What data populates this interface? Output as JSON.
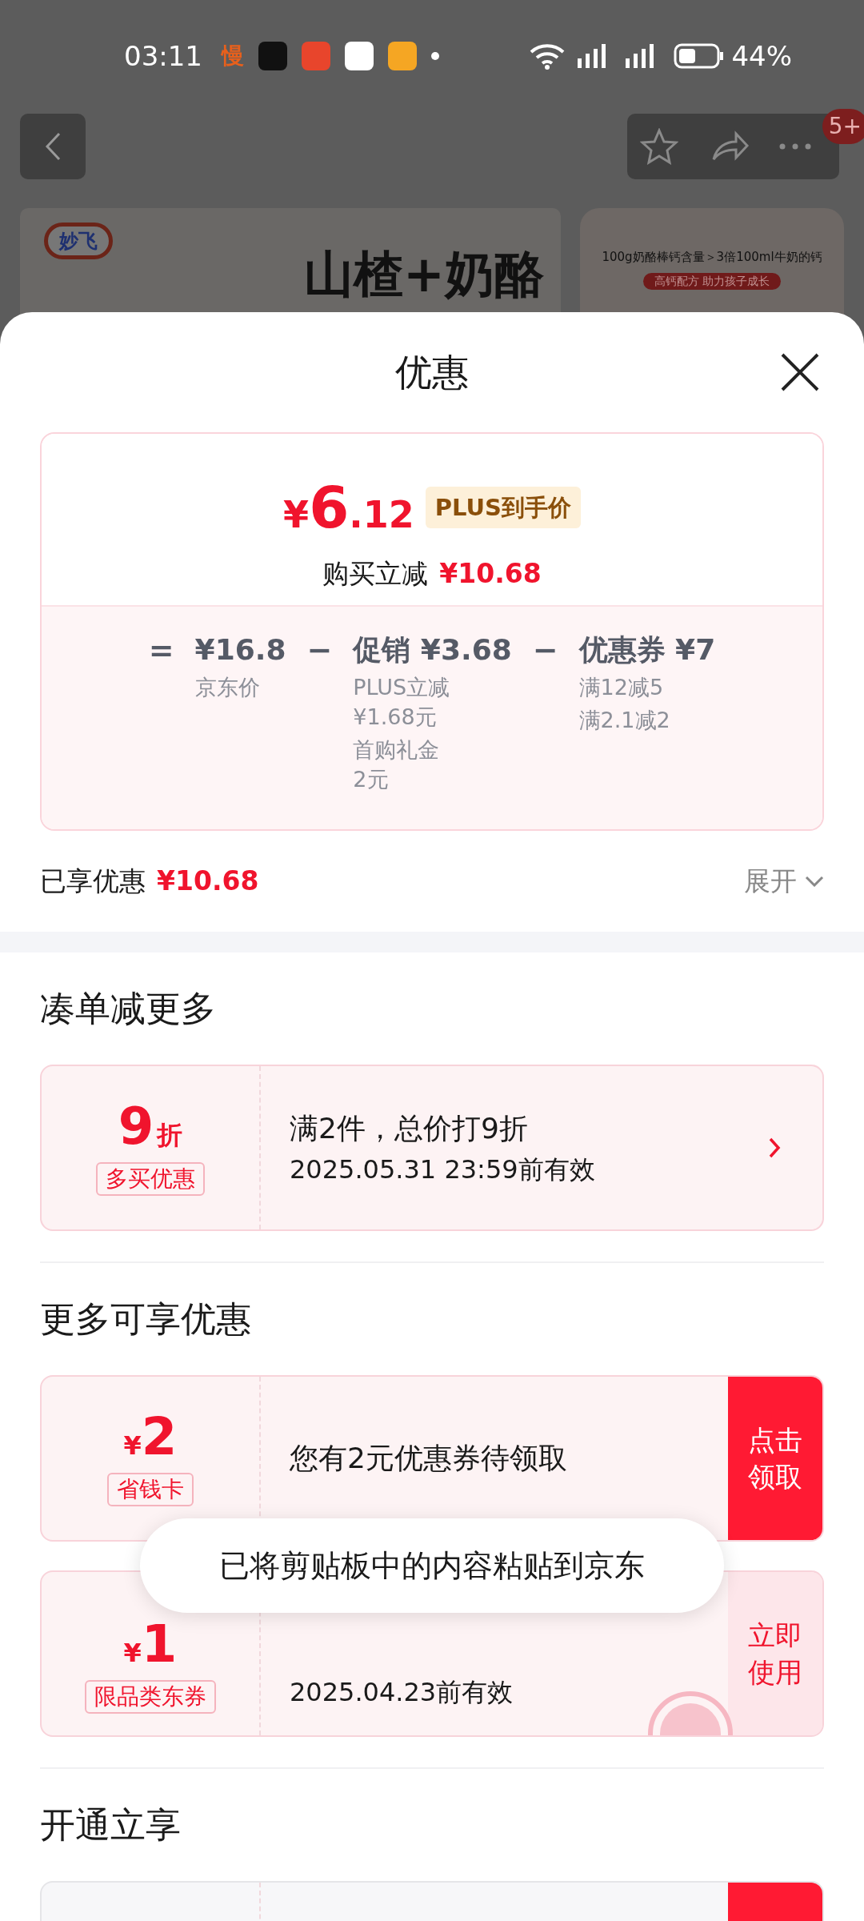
{
  "status_bar": {
    "time": "03:11",
    "battery": "44%",
    "notification_apps": [
      {
        "kind": "text",
        "label": "慢"
      },
      {
        "kind": "app",
        "color": "#111111"
      },
      {
        "kind": "app",
        "color": "#e8452c"
      },
      {
        "kind": "app",
        "color": "#ffffff"
      },
      {
        "kind": "app",
        "color": "#f5a623"
      }
    ]
  },
  "header": {
    "badge": "5+"
  },
  "banner": {
    "logo": "妙飞",
    "headline": "山楂+奶酪",
    "side_text": "100g奶酪棒钙含量＞3倍100ml牛奶的钙",
    "side_tag": "高钙配方  助力孩子成长"
  },
  "sheet": {
    "title": "优惠",
    "summary": {
      "currency": "¥",
      "price_int": "6",
      "price_dec": ".12",
      "plus_tag": "PLUS到手价",
      "reduce_label": "购买立减",
      "reduce_value": "¥10.68",
      "formula": [
        {
          "kind": "op",
          "text": "="
        },
        {
          "kind": "term",
          "head": "¥16.8",
          "notes": [
            "京东价"
          ]
        },
        {
          "kind": "op",
          "text": "−"
        },
        {
          "kind": "term",
          "head": "促销 ¥3.68",
          "notes": [
            "PLUS立减\n¥1.68元",
            "首购礼金\n2元"
          ]
        },
        {
          "kind": "op",
          "text": "−"
        },
        {
          "kind": "term",
          "head": "优惠券 ¥7",
          "notes": [
            "满12减5",
            "满2.1减2"
          ]
        }
      ]
    },
    "enjoyed": {
      "label": "已享优惠",
      "value": "¥10.68",
      "expand": "展开"
    },
    "sections": [
      {
        "title": "凑单减更多",
        "coupons": [
          {
            "kind": "discount",
            "big": "9",
            "unit": "折",
            "tag": "多买优惠",
            "title": "满2件，总价打9折",
            "subtitle": "2025.05.31 23:59前有效",
            "action": {
              "kind": "arrow"
            }
          }
        ]
      },
      {
        "title": "更多可享优惠",
        "coupons": [
          {
            "kind": "money",
            "big": "2",
            "unit": "¥",
            "tag": "省钱卡",
            "title": "您有2元优惠券待领取",
            "action": {
              "kind": "solid",
              "label": "点击领取"
            }
          },
          {
            "kind": "money",
            "big": "1",
            "unit": "¥",
            "tag": "限品类东券",
            "subtitle": "2025.04.23前有效",
            "action": {
              "kind": "outline",
              "label": "立即使用"
            },
            "claimed": true
          }
        ]
      },
      {
        "title": "开通立享",
        "coupons": [
          {
            "kind": "partial",
            "action": {
              "kind": "solid"
            }
          }
        ]
      }
    ]
  },
  "toast": "已将剪贴板中的内容粘贴到京东"
}
